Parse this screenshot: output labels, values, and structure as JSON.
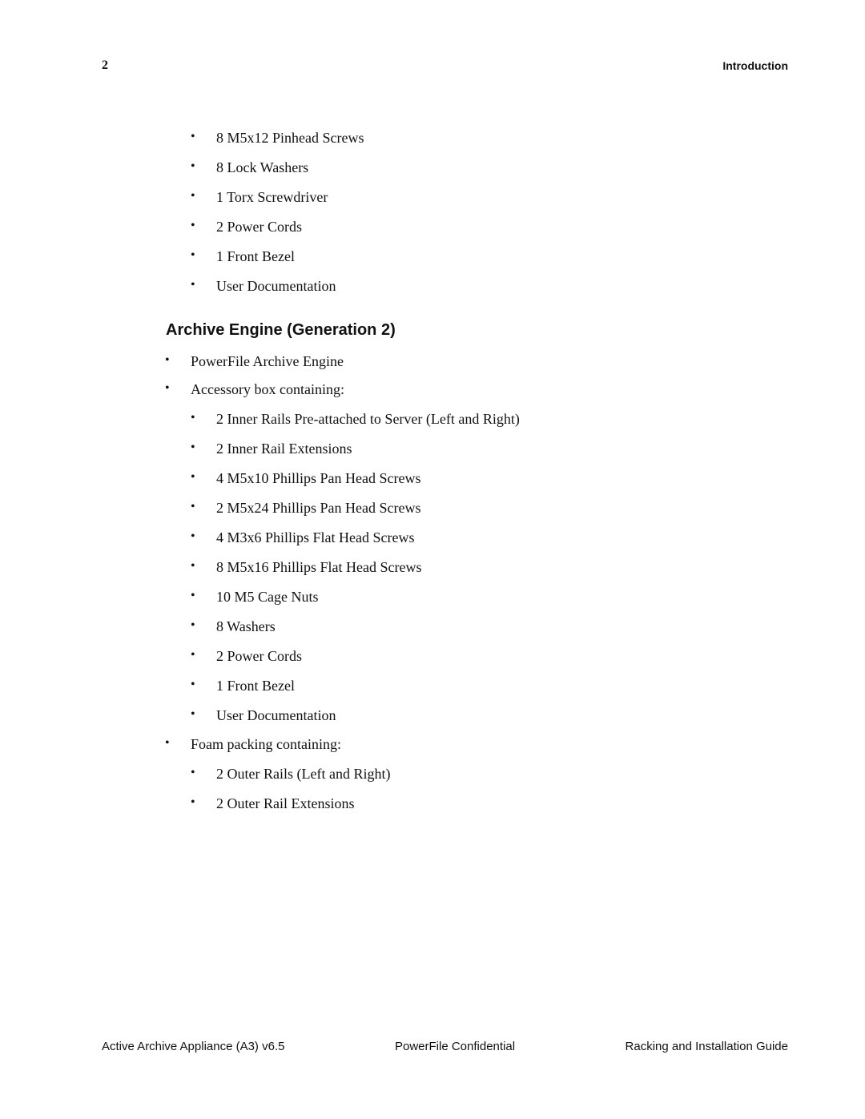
{
  "header": {
    "page_number": "2",
    "running_head": "Introduction"
  },
  "top_list": [
    "8 M5x12 Pinhead Screws",
    "8 Lock Washers",
    "1 Torx Screwdriver",
    "2 Power Cords",
    "1 Front Bezel",
    "User Documentation"
  ],
  "section": {
    "title": "Archive Engine (Generation 2)",
    "items": [
      {
        "level": 1,
        "text": "PowerFile Archive Engine"
      },
      {
        "level": 1,
        "text": "Accessory box containing:"
      },
      {
        "level": 2,
        "text": "2 Inner Rails Pre-attached to Server (Left and Right)"
      },
      {
        "level": 2,
        "text": "2 Inner Rail Extensions"
      },
      {
        "level": 2,
        "text": "4 M5x10 Phillips Pan Head Screws"
      },
      {
        "level": 2,
        "text": "2 M5x24 Phillips Pan Head Screws"
      },
      {
        "level": 2,
        "text": "4 M3x6 Phillips Flat Head Screws"
      },
      {
        "level": 2,
        "text": "8 M5x16 Phillips Flat Head Screws"
      },
      {
        "level": 2,
        "text": "10 M5 Cage Nuts"
      },
      {
        "level": 2,
        "text": "8 Washers"
      },
      {
        "level": 2,
        "text": "2 Power Cords"
      },
      {
        "level": 2,
        "text": "1 Front Bezel"
      },
      {
        "level": 2,
        "text": "User Documentation"
      },
      {
        "level": 1,
        "text": "Foam packing containing:"
      },
      {
        "level": 2,
        "text": "2 Outer Rails (Left and Right)"
      },
      {
        "level": 2,
        "text": "2 Outer Rail Extensions"
      }
    ]
  },
  "bullet_glyph": "•",
  "footer": {
    "left": "Active Archive Appliance (A3) v6.5",
    "center": "PowerFile Confidential",
    "right": "Racking and Installation Guide"
  }
}
